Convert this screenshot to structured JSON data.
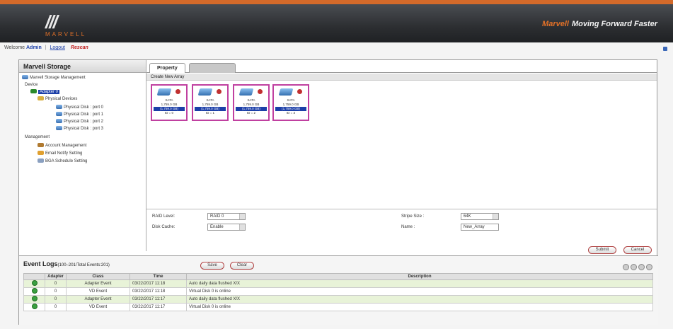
{
  "header": {
    "logo_text": "MARVELL",
    "tagline_brand": "Marvell",
    "tagline_text": "Moving Forward Faster"
  },
  "welcome": {
    "prefix": "Welcome",
    "user": "Admin",
    "logout": "Logout",
    "rescan": "Rescan"
  },
  "tree": {
    "title": "Marvell Storage",
    "root": "Marvell Storage Management",
    "device": "Device",
    "adapter": "Adapter 0",
    "physical_devices": "Physical Devices",
    "disks": [
      "Physical Disk : port 0",
      "Physical Disk : port 1",
      "Physical Disk : port 2",
      "Physical Disk : port 3"
    ],
    "management": "Management",
    "account": "Account Management",
    "email": "Email Notify Setting",
    "bga": "BGA Schedule Setting"
  },
  "tabs": {
    "property": "Property"
  },
  "sub_title": "Create New Array",
  "disks": [
    {
      "type": "SATA",
      "size": "1,759.0 GB",
      "free": "(1,759.0 GB)",
      "id": "ID = 0"
    },
    {
      "type": "SATA",
      "size": "1,759.0 GB",
      "free": "(1,759.0 GB)",
      "id": "ID = 1"
    },
    {
      "type": "SATA",
      "size": "1,759.0 GB",
      "free": "(1,759.0 GB)",
      "id": "ID = 2"
    },
    {
      "type": "SATA",
      "size": "1,759.0 GB",
      "free": "(1,759.0 GB)",
      "id": "ID = 3"
    }
  ],
  "form": {
    "raid_label": "RAID Level:",
    "raid_value": "RAID 0",
    "disk_cache_label": "Disk Cache:",
    "disk_cache_value": "Enable",
    "stripe_label": "Stripe Size :",
    "stripe_value": "64K",
    "name_label": "Name :",
    "name_value": "New_Array",
    "submit": "Submit",
    "cancel": "Cancel"
  },
  "events": {
    "title": "Event Logs",
    "subtitle": "(100–201/Total Events:201)",
    "btn_save": "Save",
    "btn_clear": "Clear",
    "columns": [
      "",
      "Adapter",
      "Class",
      "Time",
      "Description"
    ],
    "rows": [
      {
        "adapter": "0",
        "class": "Adapter Event",
        "time": "03/22/2017 11:18",
        "desc": "Auto daily data flushed X/X"
      },
      {
        "adapter": "0",
        "class": "VD Event",
        "time": "03/22/2017 11:18",
        "desc": "Virtual Disk 0 is online"
      },
      {
        "adapter": "0",
        "class": "Adapter Event",
        "time": "03/22/2017 11:17",
        "desc": "Auto daily data flushed X/X"
      },
      {
        "adapter": "0",
        "class": "VD Event",
        "time": "03/22/2017 11:17",
        "desc": "Virtual Disk 0 is online"
      }
    ]
  }
}
